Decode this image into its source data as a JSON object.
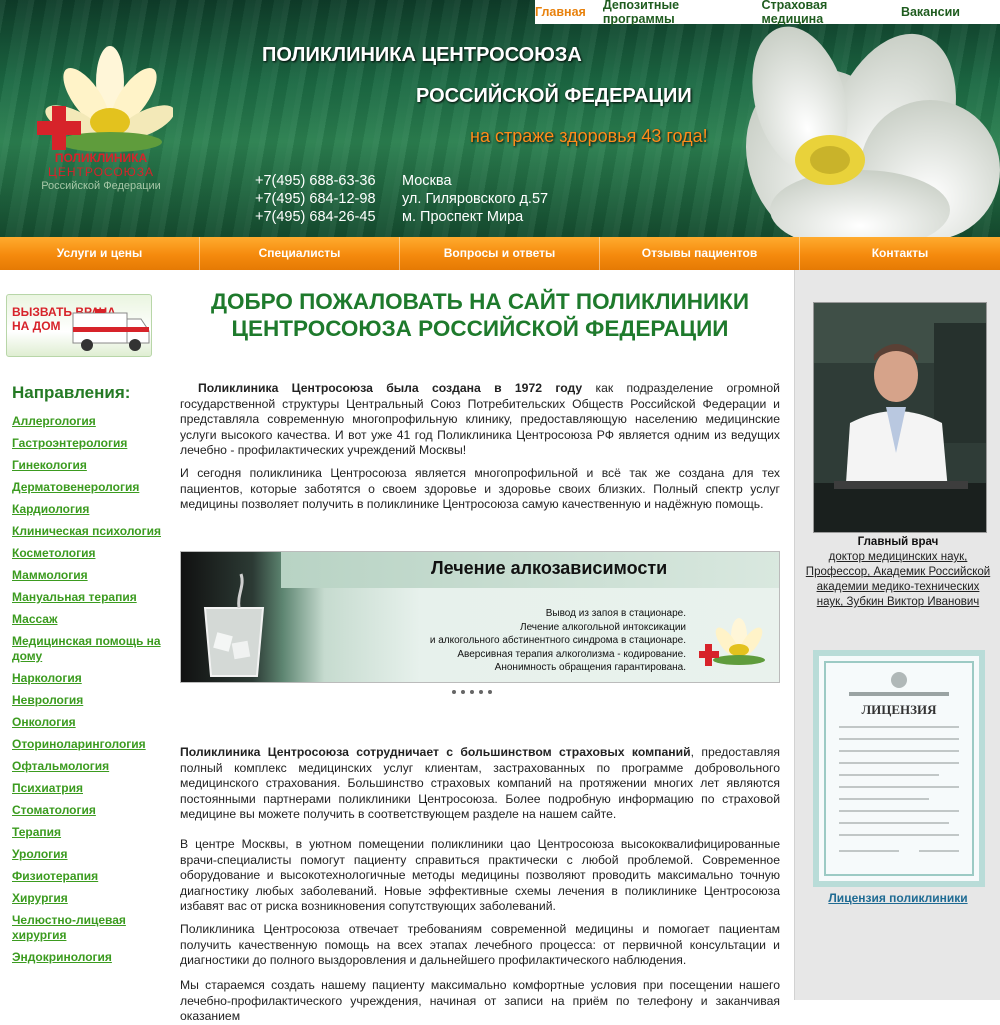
{
  "top_nav": [
    {
      "label": "Главная",
      "active": true
    },
    {
      "label": "Депозитные программы",
      "active": false
    },
    {
      "label": "Страховая медицина",
      "active": false
    },
    {
      "label": "Вакансии",
      "active": false
    }
  ],
  "logo": {
    "line1": "ПОЛИКЛИНИКА",
    "line2": "ЦЕНТРОСОЮЗА",
    "line3": "Российской Федерации"
  },
  "header": {
    "title_line1": "ПОЛИКЛИНИКА ЦЕНТРОСОЮЗА",
    "title_line2": "РОССИЙСКОЙ ФЕДЕРАЦИИ",
    "slogan": "на страже здоровья 43 года!",
    "phones": [
      "+7(495) 688-63-36",
      "+7(495) 684-12-98",
      "+7(495) 684-26-45"
    ],
    "address": [
      "Москва",
      "ул. Гиляровского д.57",
      "м. Проспект Мира"
    ]
  },
  "main_nav": [
    "Услуги и цены",
    "Специалисты",
    "Вопросы и ответы",
    "Отзывы пациентов",
    "Контакты"
  ],
  "left": {
    "ambulance_banner": {
      "line1": "ВЫЗВАТЬ ВРАЧА",
      "line2": "НА ДОМ"
    },
    "directions_title": "Направления:",
    "directions": [
      "Аллергология",
      "Гастроэнтерология",
      "Гинекология",
      "Дерматовенерология",
      "Кардиология",
      "Клиническая психология",
      "Косметология",
      "Маммология",
      "Мануальная терапия",
      "Массаж",
      "Медицинская помощь на дому",
      "Наркология",
      "Неврология",
      "Онкология",
      "Оториноларингология",
      "Офтальмология",
      "Психиатрия",
      "Стоматология",
      "Терапия",
      "Урология",
      "Физиотерапия",
      "Хирургия",
      "Челюстно-лицевая хирургия",
      "Эндокринология"
    ]
  },
  "center": {
    "welcome": "ДОБРО ПОЖАЛОВАТЬ НА САЙТ ПОЛИКЛИНИКИ ЦЕНТРОСОЮЗА РОССИЙСКОЙ ФЕДЕРАЦИИ",
    "p1_bold": "Поликлиника Центросоюза была создана в 1972 году",
    "p1_rest": " как подразделение огромной государственной структуры Центральный Союз Потребительских Обществ Российской Федерации и представляла современную многопрофильную клинику, предоставляющую населению медицинские услуги высокого качества. И вот уже  41 год Поликлиника Центросоюза РФ является одним из ведущих лечебно - профилактических учреждений  Москвы!",
    "p2": "И сегодня поликлиника Центросоюза является многопрофильной и всё так же создана для тех пациентов, которые заботятся о своем здоровье и здоровье своих близких. Полный спектр услуг медицины позволяет получить в поликлинике Центросоюза самую качественную и надёжную помощь.",
    "banner": {
      "title": "Лечение алкозависимости",
      "lines": [
        "Вывод из запоя в стационаре.",
        "Лечение алкогольной интоксикации",
        "и алкогольного абстинентного синдрома в стационаре.",
        "Аверсивная терапия алкоголизма - кодирование.",
        "Анонимность обращения гарантирована."
      ]
    },
    "slider_dots": 5,
    "p3_bold": "Поликлиника Центросоюза сотрудничает с большинством страховых компаний",
    "p3_rest": ", предоставляя полный комплекс медицинских услуг клиентам, застрахованных по программе добровольного медицинского страхования. Большинство страховых компаний на протяжении многих лет являются постоянными партнерами поликлиники Центросоюза. Более подробную информацию по страховой медицине вы можете получить в соответствующем разделе на нашем сайте.",
    "p4": "В центре Москвы, в уютном помещении  поликлиники цао Центросоюза высококвалифицированные врачи-специалисты помогут пациенту справиться практически с любой проблемой. Современное оборудование и высокотехнологичные методы медицины позволяют проводить максимально точную диагностику любых заболеваний.  Новые эффективные схемы лечения в поликлинике Центросоюза избавят вас от риска возникновения сопутствующих заболеваний.",
    "p5": "Поликлиника Центросоюза отвечает требованиям современной медицины и помогает пациентам получить качественную помощь на всех этапах лечебного процесса: от первичной консультации и диагностики до полного выздоровления и дальнейшего профилактического наблюдения.",
    "p6": "Мы стараемся создать нашему пациенту максимально комфортные условия при посещении нашего лечебно-профилактического учреждения, начиная от записи на приём по телефону и заканчивая оказанием"
  },
  "right": {
    "doctor_heading": "Главный врач",
    "doctor_desc": "доктор медицинских наук, Профессор, Академик Российской академии медико-технических наук, Зубкин Виктор Иванович",
    "license_title": "ЛИЦЕНЗИЯ",
    "license_link": "Лицензия поликлиники"
  },
  "colors": {
    "accent_orange": "#f58a0d",
    "green_link": "#3b9b1f",
    "heading_green": "#1e7a2c"
  }
}
